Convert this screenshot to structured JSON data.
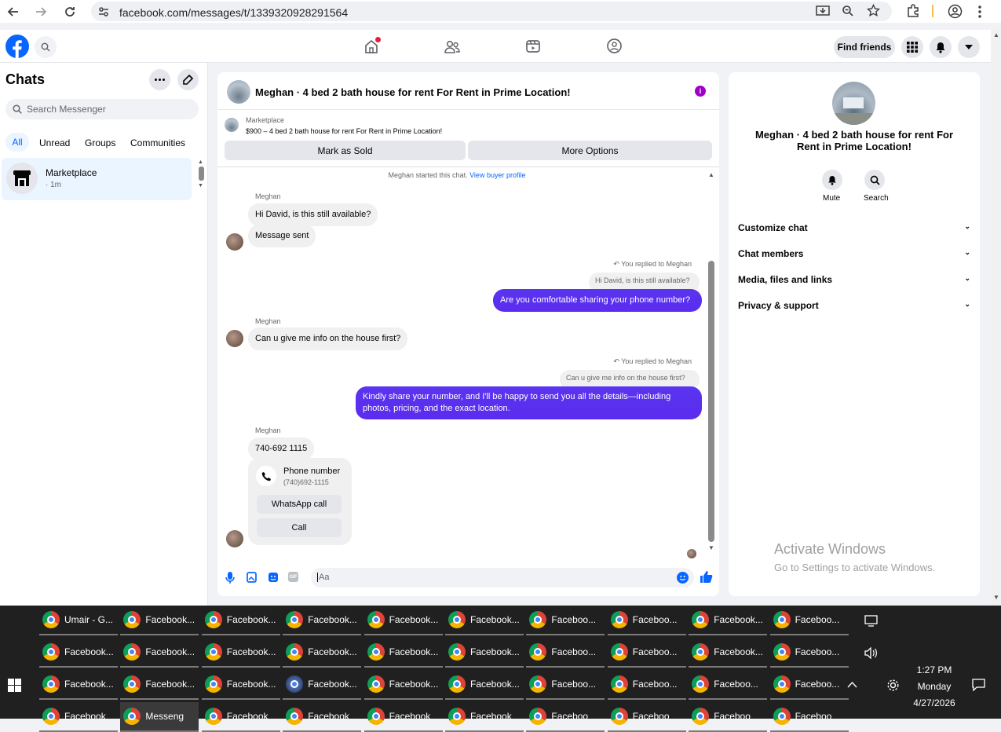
{
  "browser": {
    "url": "facebook.com/messages/t/1339320928291564"
  },
  "header": {
    "find_friends": "Find friends"
  },
  "left": {
    "title": "Chats",
    "search_placeholder": "Search Messenger",
    "filters": [
      "All",
      "Unread",
      "Groups",
      "Communities"
    ],
    "chat": {
      "name": "Marketplace",
      "meta": "· 1m"
    }
  },
  "center": {
    "title": "Meghan · 4 bed 2 bath house for rent For Rent in Prime Location!",
    "listing": {
      "label": "Marketplace",
      "desc": "$900 – 4 bed 2 bath house for rent For Rent in Prime Location!"
    },
    "mark_sold": "Mark as Sold",
    "more_options": "More Options",
    "started": "Meghan started this chat.",
    "view_buyer": "View buyer profile",
    "messages": {
      "sender": "Meghan",
      "m1": "Hi David, is this still available?",
      "m2": "Message sent",
      "reply1_label": "You replied to Meghan",
      "reply1_quote": "Hi David, is this still available?",
      "r1": "Are you comfortable sharing your phone number?",
      "m3": "Can u give me info on the house first?",
      "reply2_label": "You replied to Meghan",
      "reply2_quote": "Can u give me info on the house first?",
      "r2": "Kindly share your number, and I'll be happy to send you all the details—including photos, pricing, and the exact location.",
      "m4": "740-692 1115",
      "phone_title": "Phone number",
      "phone_value": "(740)692-1115",
      "whatsapp": "WhatsApp call",
      "call": "Call"
    },
    "composer_placeholder": "Aa"
  },
  "right": {
    "title": "Meghan · 4 bed 2 bath house for rent For Rent in Prime Location!",
    "mute": "Mute",
    "search": "Search",
    "sections": [
      "Customize chat",
      "Chat members",
      "Media, files and links",
      "Privacy & support"
    ],
    "watermark_title": "Activate Windows",
    "watermark_sub": "Go to Settings to activate Windows."
  },
  "taskbar": {
    "row1": [
      "Umair - G...",
      "Facebook...",
      "Facebook...",
      "Facebook...",
      "Facebook...",
      "Facebook...",
      "Faceboo...",
      "Faceboo...",
      "Facebook...",
      "Faceboo..."
    ],
    "row2": [
      "Facebook...",
      "Facebook...",
      "Facebook...",
      "Facebook...",
      "Facebook...",
      "Facebook...",
      "Faceboo...",
      "Faceboo...",
      "Facebook...",
      "Faceboo..."
    ],
    "row3": [
      "Facebook...",
      "Facebook...",
      "Facebook...",
      "Facebook...",
      "Facebook...",
      "Facebook...",
      "Faceboo...",
      "Faceboo...",
      "Faceboo...",
      "Faceboo..."
    ],
    "row4": [
      "Facebook",
      "Messeng",
      "Facebook",
      "Facebook",
      "Facebook",
      "Facebook",
      "Faceboo",
      "Faceboo",
      "Faceboo",
      "Faceboo"
    ],
    "time": "1:27 PM",
    "day": "Monday",
    "date": "4/27/2026"
  },
  "colors": {
    "fb_blue": "#0866ff",
    "message_purple": "#5b2cef"
  }
}
